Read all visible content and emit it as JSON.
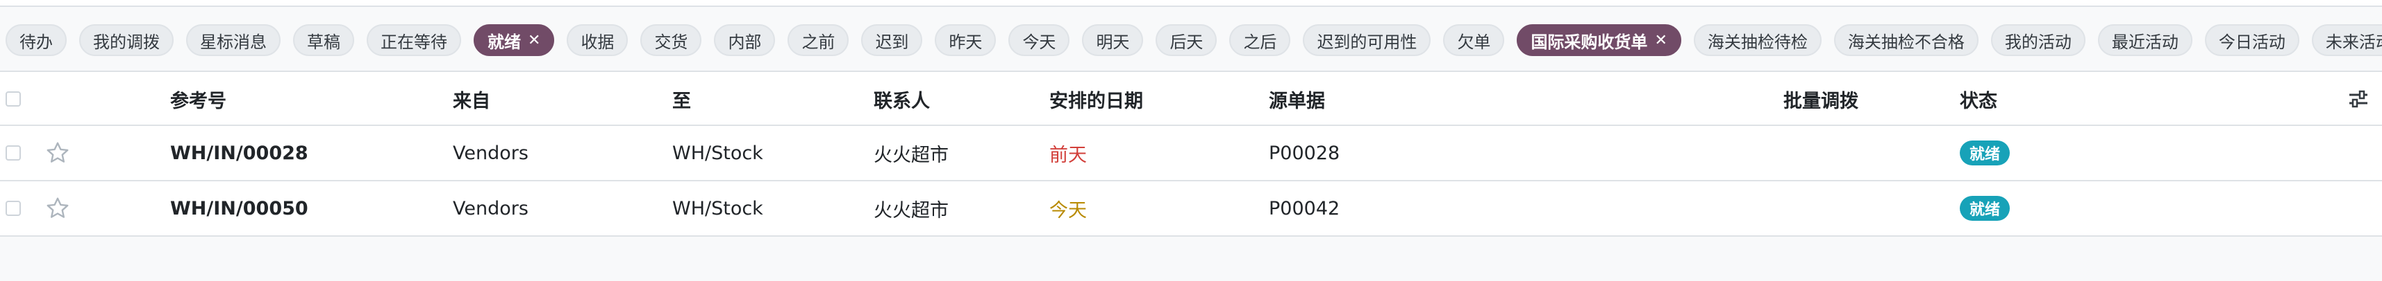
{
  "filters": [
    {
      "label": "待办",
      "active": false
    },
    {
      "label": "我的调拨",
      "active": false
    },
    {
      "label": "星标消息",
      "active": false
    },
    {
      "label": "草稿",
      "active": false
    },
    {
      "label": "正在等待",
      "active": false
    },
    {
      "label": "就绪",
      "active": true
    },
    {
      "label": "收据",
      "active": false
    },
    {
      "label": "交货",
      "active": false
    },
    {
      "label": "内部",
      "active": false
    },
    {
      "label": "之前",
      "active": false
    },
    {
      "label": "迟到",
      "active": false
    },
    {
      "label": "昨天",
      "active": false
    },
    {
      "label": "今天",
      "active": false
    },
    {
      "label": "明天",
      "active": false
    },
    {
      "label": "后天",
      "active": false
    },
    {
      "label": "之后",
      "active": false
    },
    {
      "label": "迟到的可用性",
      "active": false
    },
    {
      "label": "欠单",
      "active": false
    },
    {
      "label": "国际采购收货单",
      "active": true
    },
    {
      "label": "海关抽检待检",
      "active": false
    },
    {
      "label": "海关抽检不合格",
      "active": false
    },
    {
      "label": "我的活动",
      "active": false
    },
    {
      "label": "最近活动",
      "active": false
    },
    {
      "label": "今日活动",
      "active": false
    },
    {
      "label": "未来活动",
      "active": false
    }
  ],
  "chip_close_glyph": "✕",
  "columns": {
    "reference": "参考号",
    "from": "来自",
    "to": "至",
    "contact": "联系人",
    "scheduled_date": "安排的日期",
    "source_document": "源单据",
    "batch_transfer": "批量调拨",
    "status": "状态"
  },
  "rows": [
    {
      "reference": "WH/IN/00028",
      "from": "Vendors",
      "to": "WH/Stock",
      "contact": "火火超市",
      "scheduled_date": "前天",
      "date_color": "#d23f3a",
      "source_document": "P00028",
      "batch_transfer": "",
      "status": "就绪"
    },
    {
      "reference": "WH/IN/00050",
      "from": "Vendors",
      "to": "WH/Stock",
      "contact": "火火超市",
      "scheduled_date": "今天",
      "date_color": "#b88a00",
      "source_document": "P00042",
      "batch_transfer": "",
      "status": "就绪"
    }
  ],
  "colors": {
    "accent": "#714b67",
    "status_badge": "#17a2b8"
  },
  "icons": {
    "star": "star-icon",
    "settings": "optional-columns-icon"
  }
}
